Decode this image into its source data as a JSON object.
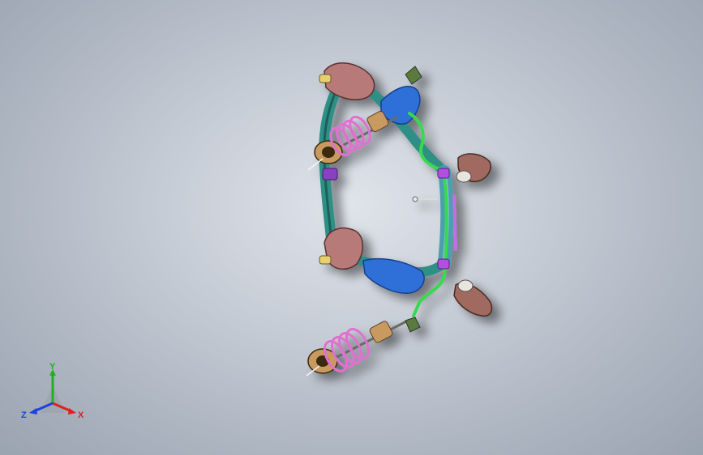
{
  "triad": {
    "x_label": "X",
    "y_label": "Y",
    "z_label": "Z",
    "x_color": "#e02020",
    "y_color": "#20b020",
    "z_color": "#2040e0"
  },
  "colors": {
    "frame_teal": "#2f8f84",
    "frame_dark": "#1f5f5a",
    "brush_pink": "#b87a78",
    "spring_magenta": "#e070d0",
    "arm_blue": "#2f6fd8",
    "stabilizer_green": "#38d850",
    "bushing_purple": "#8a3fc0",
    "strut_tan": "#c89a60"
  }
}
